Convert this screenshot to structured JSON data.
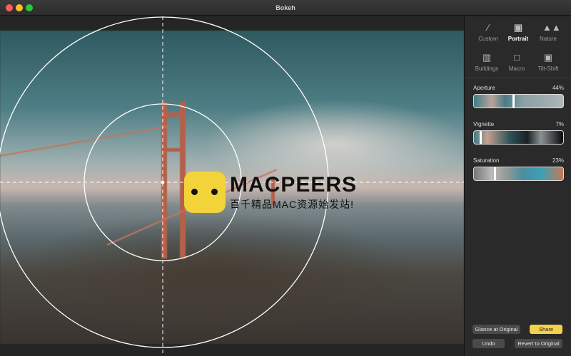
{
  "window": {
    "title": "Bokeh"
  },
  "colors": {
    "accent": "#f5d04a",
    "close": "#fc5f57",
    "minimize": "#fdbc2e",
    "zoom": "#28c840"
  },
  "watermark": {
    "brand": "MACPEERS",
    "tagline": "百千精品MAC资源始发站!"
  },
  "presets": [
    {
      "label": "Custom",
      "icon": "brush-icon"
    },
    {
      "label": "Portrait",
      "icon": "portrait-icon",
      "selected": true
    },
    {
      "label": "Nature",
      "icon": "trees-icon"
    },
    {
      "label": "Buildings",
      "icon": "buildings-icon"
    },
    {
      "label": "Macro",
      "icon": "square-icon"
    },
    {
      "label": "Tilt-Shift",
      "icon": "portrait-icon"
    }
  ],
  "sliders": [
    {
      "label": "Aperture",
      "value_text": "44%",
      "value": 44
    },
    {
      "label": "Vignette",
      "value_text": "7%",
      "value": 7
    },
    {
      "label": "Saturation",
      "value_text": "23%",
      "value": 23
    }
  ],
  "buttons": {
    "glance": "Glance at Original",
    "share": "Share",
    "undo": "Undo",
    "revert": "Revert to Original"
  }
}
